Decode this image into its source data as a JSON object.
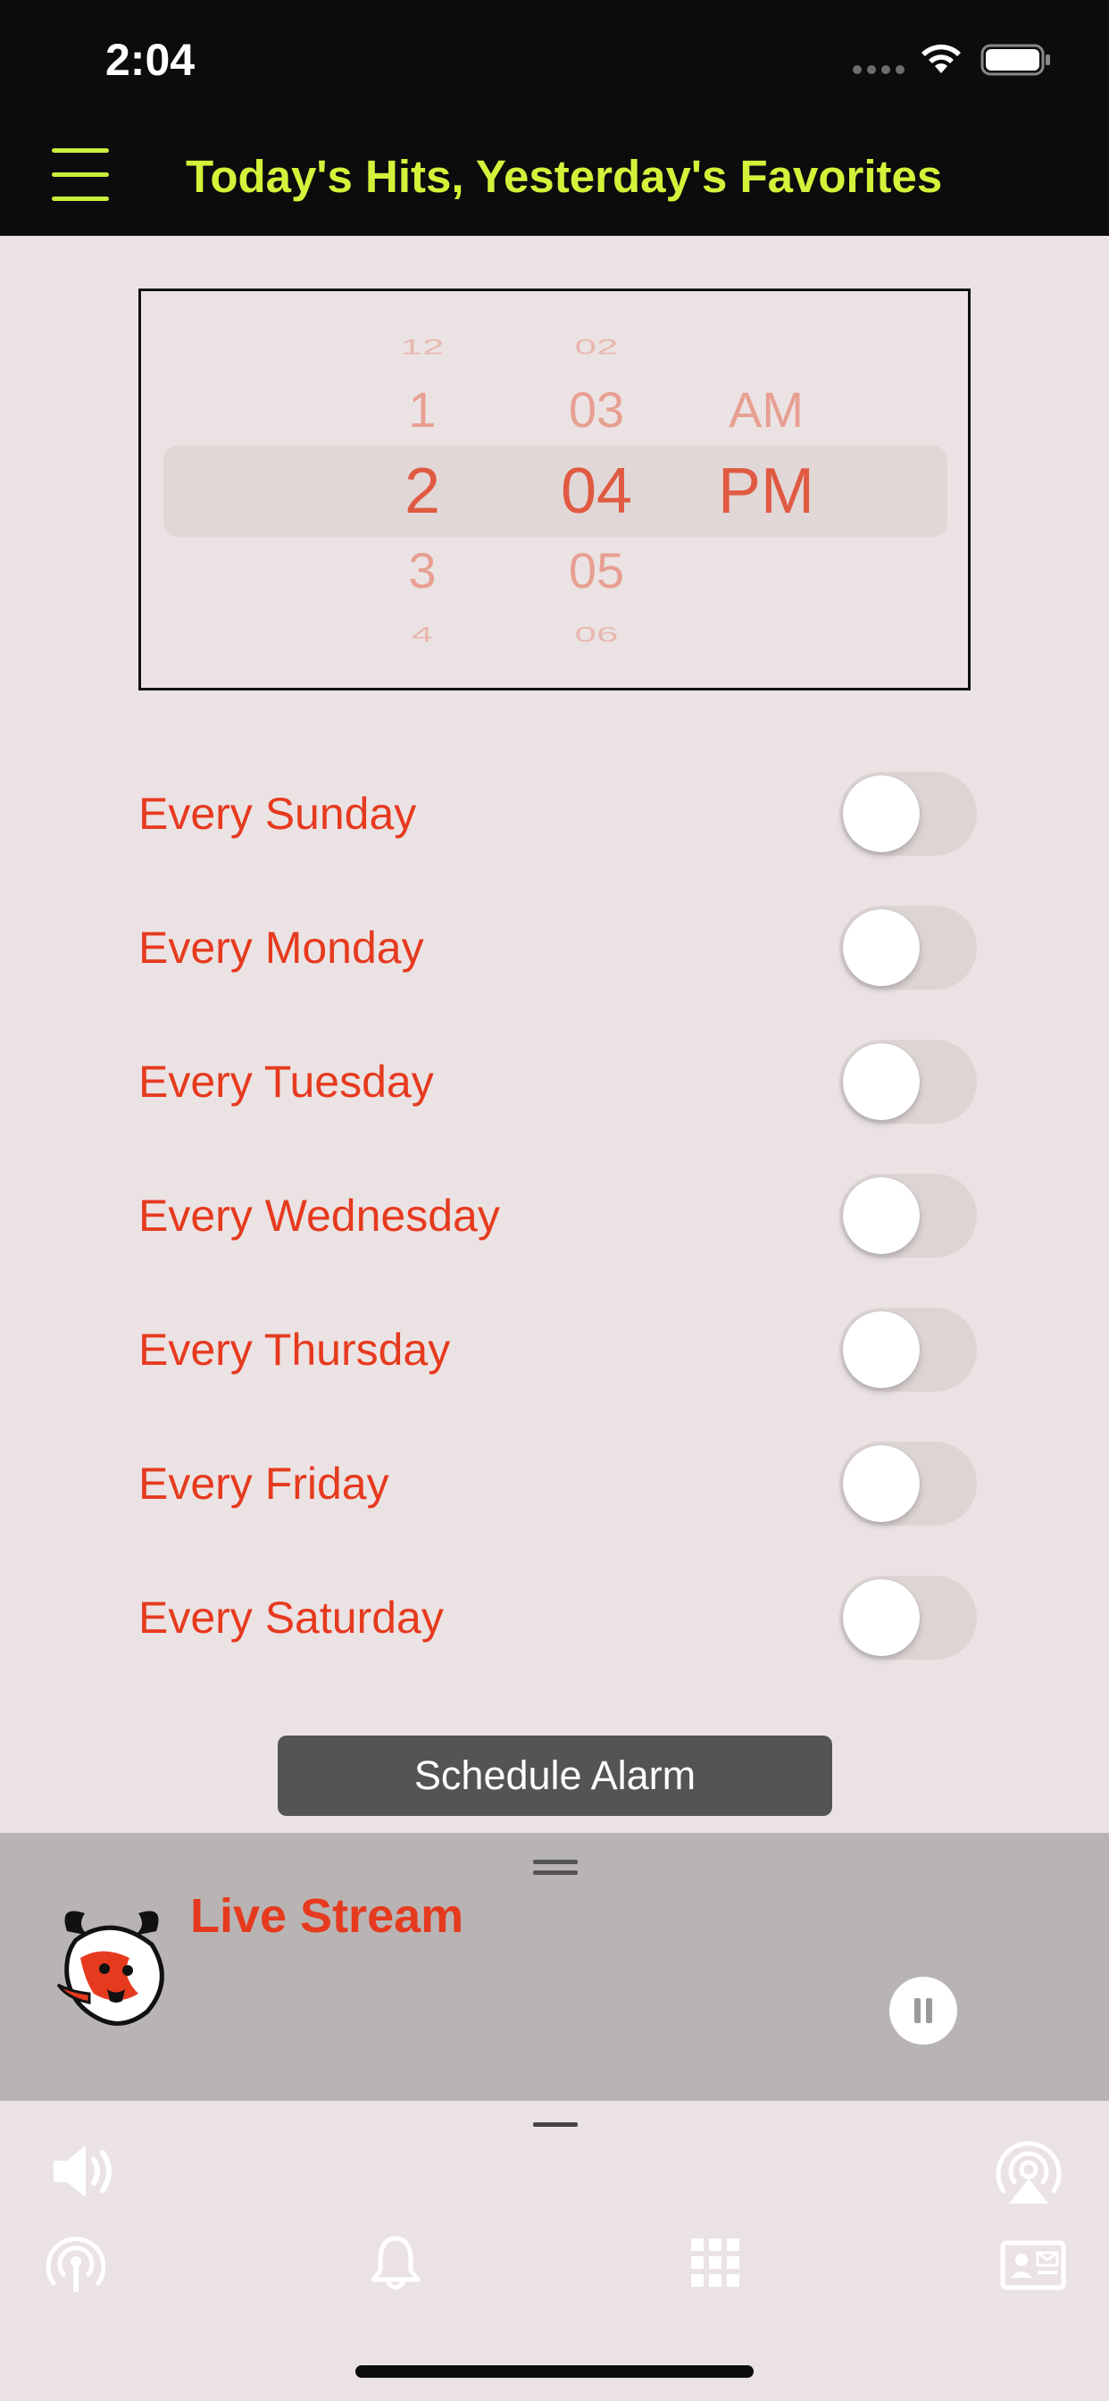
{
  "status_bar": {
    "time": "2:04"
  },
  "header": {
    "title": "Today's Hits, Yesterday's Favorites"
  },
  "picker": {
    "hours": [
      "12",
      "1",
      "2",
      "3",
      "4"
    ],
    "minutes": [
      "02",
      "03",
      "04",
      "05",
      "06"
    ],
    "periods": [
      "",
      "AM",
      "PM",
      "",
      ""
    ],
    "selected": {
      "hour": "2",
      "minute": "04",
      "period": "PM"
    }
  },
  "days": [
    {
      "label": "Every Sunday",
      "on": false
    },
    {
      "label": "Every Monday",
      "on": false
    },
    {
      "label": "Every Tuesday",
      "on": false
    },
    {
      "label": "Every Wednesday",
      "on": false
    },
    {
      "label": "Every Thursday",
      "on": false
    },
    {
      "label": "Every Friday",
      "on": false
    },
    {
      "label": "Every Saturday",
      "on": false
    }
  ],
  "schedule_button": {
    "label": "Schedule Alarm"
  },
  "player": {
    "station_name": "Live Stream",
    "state": "playing"
  },
  "toolbar": {
    "icons": [
      "volume-icon",
      "airplay-icon",
      "podcast-icon",
      "bell-icon",
      "grid-icon",
      "contact-card-icon"
    ]
  },
  "colors": {
    "accent": "#e63a1f",
    "header_bg": "#0c0c0c",
    "header_text": "#d4f23a",
    "page_bg": "#ebe3e3",
    "player_bg": "#b9b4b4"
  }
}
